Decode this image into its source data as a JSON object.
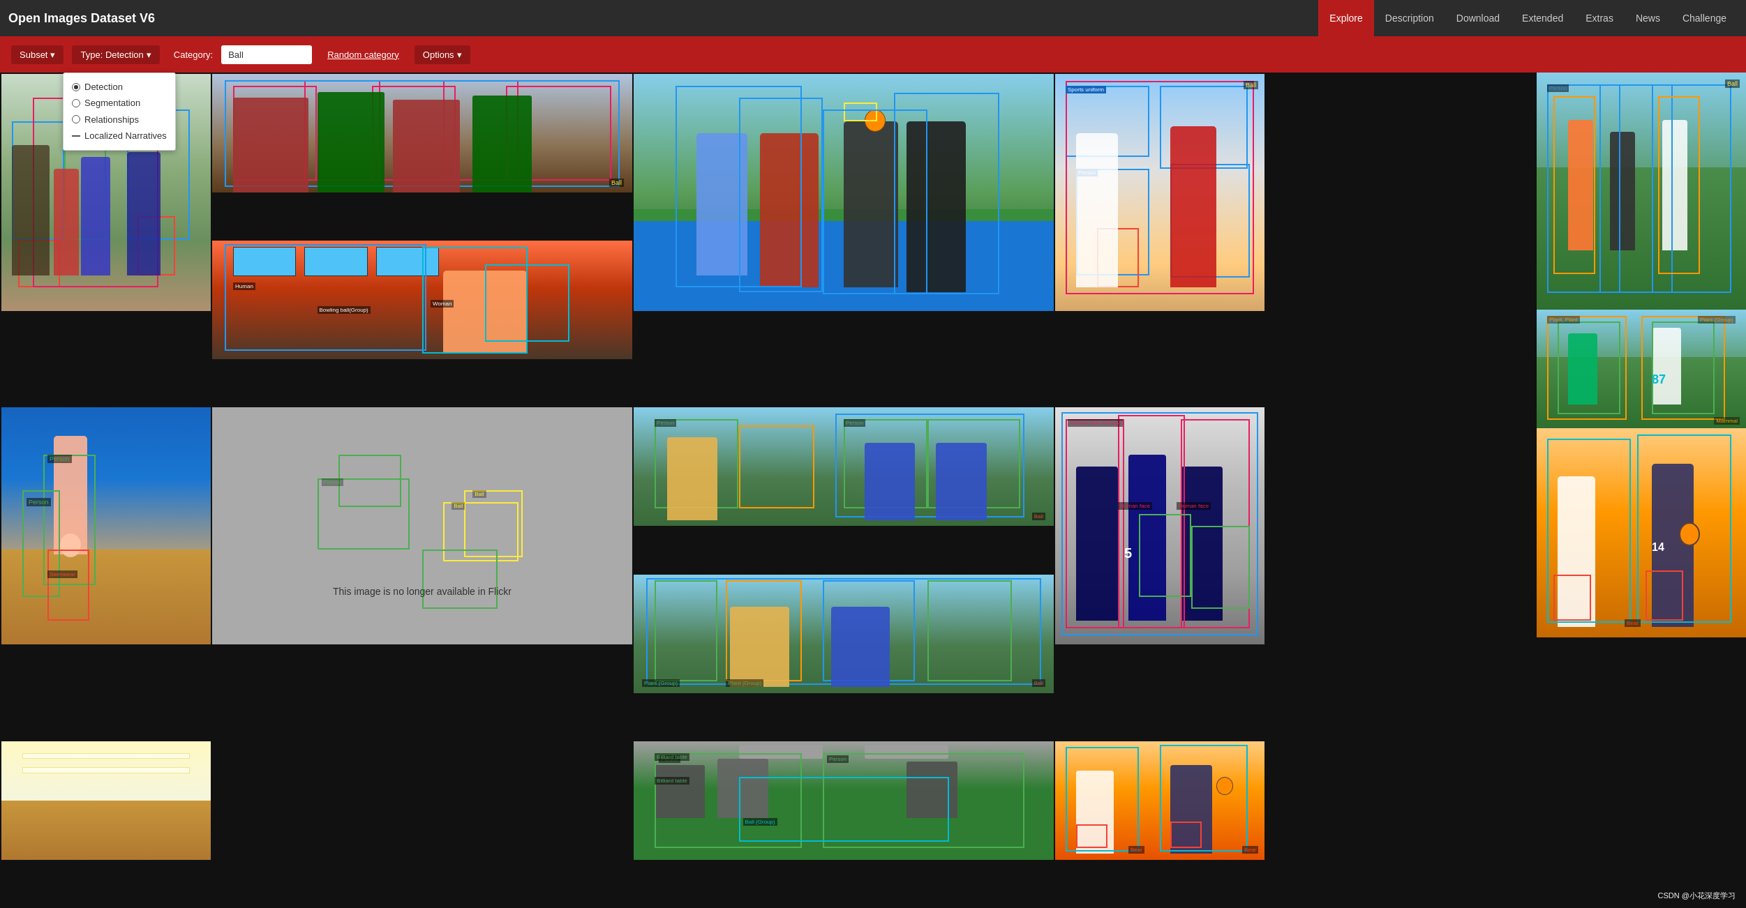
{
  "app": {
    "title": "Open Images Dataset V6"
  },
  "nav": {
    "links": [
      {
        "id": "explore",
        "label": "Explore",
        "active": true
      },
      {
        "id": "description",
        "label": "Description",
        "active": false
      },
      {
        "id": "download",
        "label": "Download",
        "active": false
      },
      {
        "id": "extended",
        "label": "Extended",
        "active": false
      },
      {
        "id": "extras",
        "label": "Extras",
        "active": false
      },
      {
        "id": "news",
        "label": "News",
        "active": false
      },
      {
        "id": "challenge",
        "label": "Challenge",
        "active": false
      }
    ]
  },
  "toolbar": {
    "subset_label": "Subset",
    "type_label": "Type: Detection",
    "category_label": "Category:",
    "category_value": "Ball",
    "random_category": "Random category",
    "options_label": "Options"
  },
  "type_dropdown": {
    "items": [
      {
        "label": "Detection",
        "selected": true,
        "type": "radio"
      },
      {
        "label": "Segmentation",
        "selected": false,
        "type": "radio"
      },
      {
        "label": "Relationships",
        "selected": false,
        "type": "radio"
      },
      {
        "label": "Localized Narratives",
        "selected": false,
        "type": "dash"
      }
    ]
  },
  "unavailable_text": "This image is no longer available in Flickr",
  "watermark": "CSDN @小花深度学习"
}
